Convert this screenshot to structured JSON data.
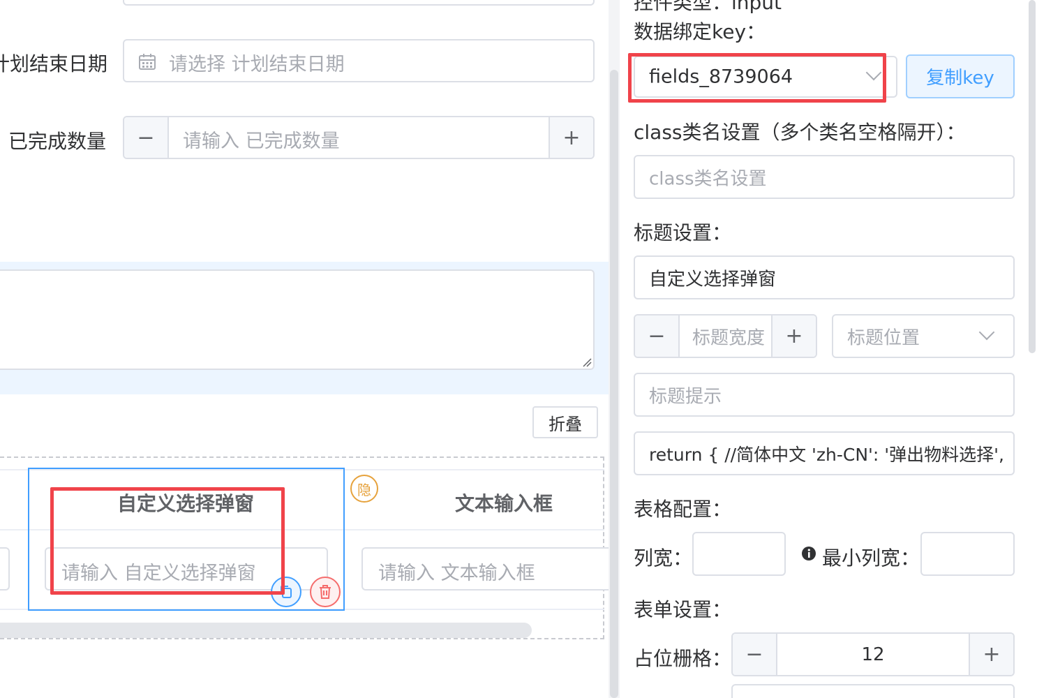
{
  "form": {
    "plan_end_label": "计划结束日期",
    "plan_end_placeholder": "请选择 计划结束日期",
    "completed_label": "已完成数量",
    "completed_placeholder": "请输入 已完成数量",
    "minus": "−",
    "plus": "+",
    "collapse_button": "折叠"
  },
  "table": {
    "col1_header": "自定义选择弹窗",
    "col1_placeholder": "请输入 自定义选择弹窗",
    "hidden_badge": "隐",
    "col2_header": "文本输入框",
    "col2_placeholder": "请输入 文本输入框"
  },
  "panel": {
    "control_type_text": "控件类型：input",
    "data_key_label": "数据绑定key：",
    "data_key_value": "fields_8739064",
    "copy_key_button": "复制key",
    "class_label": "class类名设置（多个类名空格隔开）：",
    "class_placeholder": "class类名设置",
    "title_label": "标题设置：",
    "title_value": "自定义选择弹窗",
    "title_width_placeholder": "标题宽度",
    "title_position_placeholder": "标题位置",
    "title_hint_placeholder": "标题提示",
    "i18n_value": "return {  //简体中文  'zh-CN': '弹出物料选择',",
    "table_config_label": "表格配置：",
    "col_width_label": "列宽：",
    "min_col_width_label": "最小列宽：",
    "form_settings_label": "表单设置：",
    "grid_label": "占位栅格：",
    "grid_value": "12"
  },
  "colors": {
    "highlight_red": "#f0434a",
    "primary_blue": "#409eff",
    "danger_red": "#f56c6c",
    "warning_orange": "#e6a23c"
  }
}
